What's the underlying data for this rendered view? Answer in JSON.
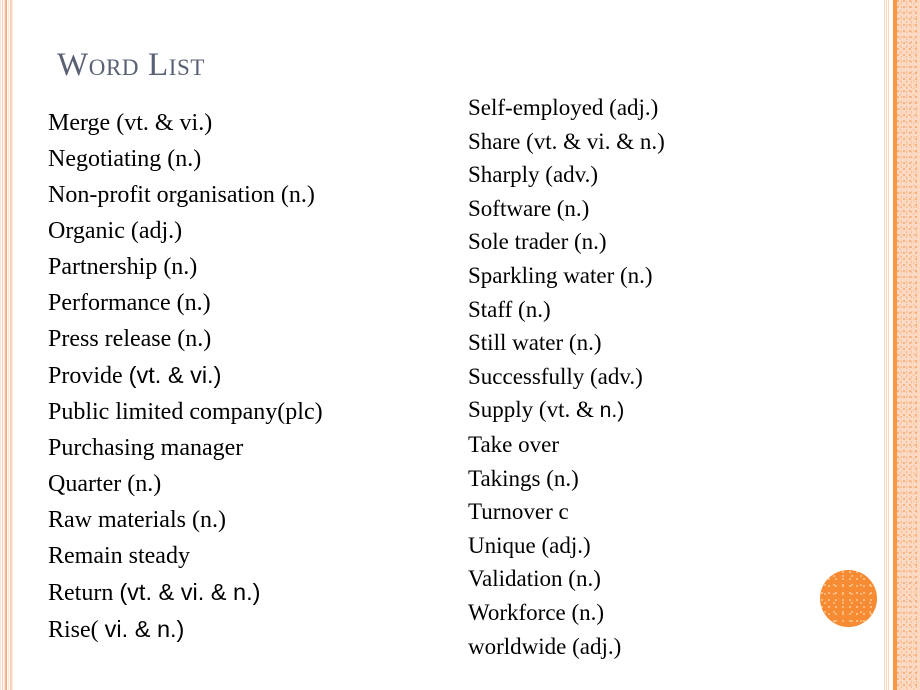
{
  "slide": {
    "title": "Word List",
    "accent_color": "#f68b33",
    "title_color": "#5a6175",
    "border_color": "#fcd9c2",
    "background_color": "#ffffff"
  },
  "columns": {
    "left": [
      {
        "head": "Merge ",
        "tail": "(vt. & vi.)",
        "tail_style": "serif"
      },
      {
        "head": "Negotiating (n.)",
        "tail": "",
        "tail_style": "serif"
      },
      {
        "head": "Non-profit organisation (n.)",
        "tail": "",
        "tail_style": "serif"
      },
      {
        "head": "Organic (adj.)",
        "tail": "",
        "tail_style": "serif"
      },
      {
        "head": "Partnership (n.)",
        "tail": "",
        "tail_style": "serif"
      },
      {
        "head": "Performance (n.)",
        "tail": "",
        "tail_style": "serif"
      },
      {
        "head": "Press release (n.)",
        "tail": "",
        "tail_style": "serif"
      },
      {
        "head": "Provide ",
        "tail": "(vt. & vi.)",
        "tail_style": "sans"
      },
      {
        "head": "Public limited company(plc)",
        "tail": "",
        "tail_style": "serif"
      },
      {
        "head": "Purchasing manager",
        "tail": "",
        "tail_style": "serif"
      },
      {
        "head": "Quarter (n.)",
        "tail": "",
        "tail_style": "serif"
      },
      {
        "head": "Raw materials (n.)",
        "tail": "",
        "tail_style": "serif"
      },
      {
        "head": "Remain steady",
        "tail": "",
        "tail_style": "serif"
      },
      {
        "head": "Return ",
        "tail": "(vt. & vi. & n.)",
        "tail_style": "sans"
      },
      {
        "head": "Rise( ",
        "tail": "vi. & n.)",
        "tail_style": "sans"
      }
    ],
    "right": [
      {
        "head": "Self-employed (adj.)",
        "tail": "",
        "tail_style": "serif"
      },
      {
        "head": "Share (vt. & vi. & n.)",
        "tail": "",
        "tail_style": "serif"
      },
      {
        "head": "Sharply (adv.)",
        "tail": "",
        "tail_style": "serif"
      },
      {
        "head": "Software (n.)",
        "tail": "",
        "tail_style": "serif"
      },
      {
        "head": "Sole trader (n.)",
        "tail": "",
        "tail_style": "serif"
      },
      {
        "head": "Sparkling water (n.)",
        "tail": "",
        "tail_style": "serif"
      },
      {
        "head": "Staff (n.)",
        "tail": "",
        "tail_style": "serif"
      },
      {
        "head": "Still water (n.)",
        "tail": "",
        "tail_style": "serif"
      },
      {
        "head": "Successfully (adv.)",
        "tail": "",
        "tail_style": "serif"
      },
      {
        "head": "Supply (vt. & ",
        "tail": "n.)",
        "tail_style": "sans-sm"
      },
      {
        "head": "Take over",
        "tail": "",
        "tail_style": "serif"
      },
      {
        "head": "Takings (n.)",
        "tail": "",
        "tail_style": "serif"
      },
      {
        "head": "Turnover c",
        "tail": "",
        "tail_style": "serif"
      },
      {
        "head": "Unique (adj.)",
        "tail": "",
        "tail_style": "serif"
      },
      {
        "head": "Validation (n.)",
        "tail": "",
        "tail_style": "serif"
      },
      {
        "head": "Workforce (n.)",
        "tail": "",
        "tail_style": "serif"
      },
      {
        "head": "worldwide (adj.)",
        "tail": "",
        "tail_style": "serif"
      }
    ]
  },
  "decorations": {
    "circle_label": "orange-circle-decoration",
    "left_border_label": "left-striped-border",
    "right_border_label": "right-striped-border"
  }
}
